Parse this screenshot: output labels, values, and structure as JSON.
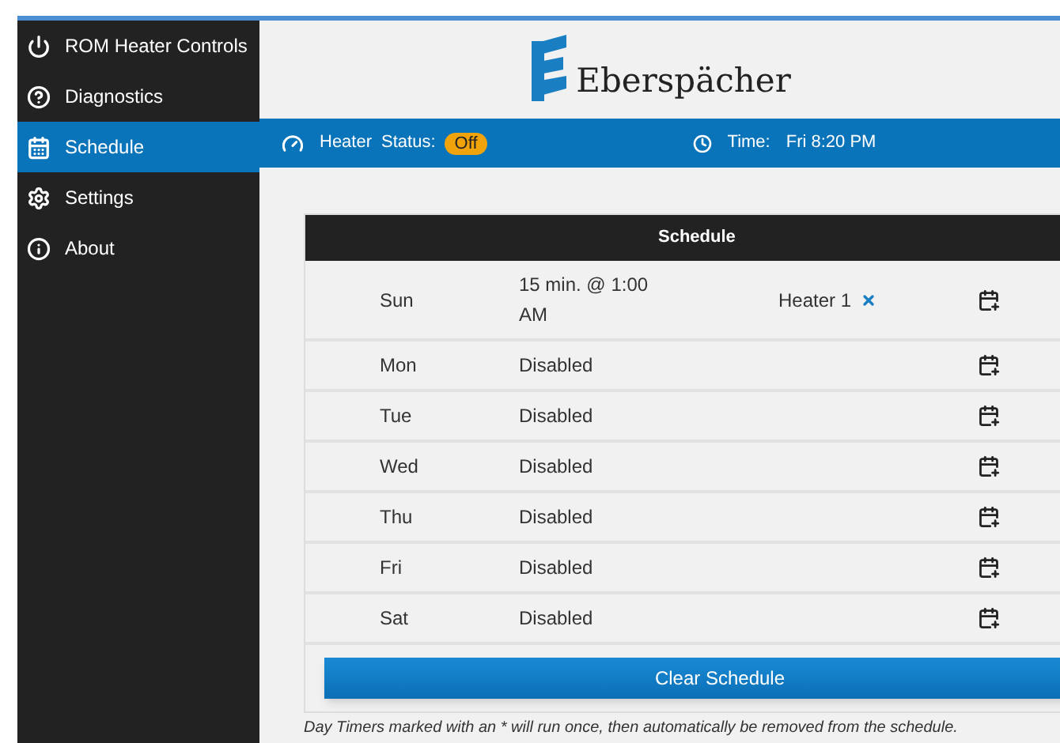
{
  "sidebar": {
    "items": [
      {
        "label": "ROM Heater Controls",
        "selected": false
      },
      {
        "label": "Diagnostics",
        "selected": false
      },
      {
        "label": "Schedule",
        "selected": true
      },
      {
        "label": "Settings",
        "selected": false
      },
      {
        "label": "About",
        "selected": false
      }
    ]
  },
  "logo": {
    "text": "Eberspächer"
  },
  "status_bar": {
    "heater_label": "Heater",
    "status_label": "Status:",
    "status": "Off",
    "time_label": "Time:",
    "time": "Fri 8:20 PM"
  },
  "schedule": {
    "title": "Schedule",
    "rows": [
      {
        "day": "Sun",
        "timer": "15 min. @ 1:00 AM",
        "heater": "Heater 1"
      },
      {
        "day": "Mon",
        "timer": "Disabled"
      },
      {
        "day": "Tue",
        "timer": "Disabled"
      },
      {
        "day": "Wed",
        "timer": "Disabled"
      },
      {
        "day": "Thu",
        "timer": "Disabled"
      },
      {
        "day": "Fri",
        "timer": "Disabled"
      },
      {
        "day": "Sat",
        "timer": "Disabled"
      }
    ],
    "clear_button": "Clear Schedule"
  },
  "footnote": "Day Timers marked with an * will run once, then automatically be removed from the schedule."
}
